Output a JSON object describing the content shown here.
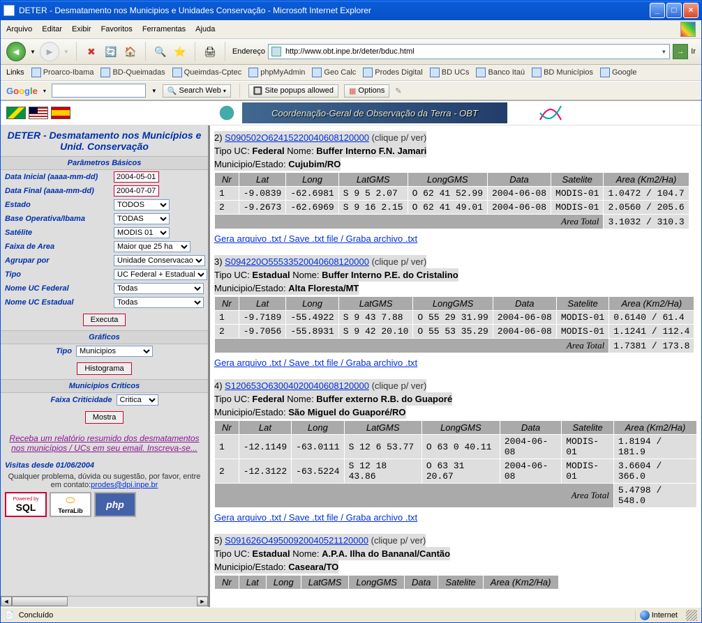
{
  "window": {
    "title": "DETER - Desmatamento nos Municipios e Unidades Conservação - Microsoft Internet Explorer"
  },
  "menus": [
    "Arquivo",
    "Editar",
    "Exibir",
    "Favoritos",
    "Ferramentas",
    "Ajuda"
  ],
  "addr": {
    "label": "Endereço",
    "url": "http://www.obt.inpe.br/deter/bduc.html",
    "go": "Ir"
  },
  "linkbar": {
    "label": "Links",
    "items": [
      "Proarco-Ibama",
      "BD-Queimadas",
      "Queimdas-Cptec",
      "phpMyAdmin",
      "Geo Calc",
      "Prodes Digital",
      "BD UCs",
      "Banco Itaú",
      "BD Municípios",
      "Google"
    ]
  },
  "google": {
    "search": "Search Web",
    "popups": "Site popups allowed",
    "options": "Options"
  },
  "obt_banner": "Coordenação-Geral de Observação da Terra - OBT",
  "left": {
    "title": "DETER - Desmatamento nos Municípios e Unid. Conservação",
    "s_basic": "Parâmetros Básicos",
    "data_ini_lbl": "Data Inicial (aaaa-mm-dd)",
    "data_ini": "2004-05-01",
    "data_fin_lbl": "Data Final (aaaa-mm-dd)",
    "data_fin": "2004-07-07",
    "estado_lbl": "Estado",
    "estado": "TODOS",
    "base_lbl": "Base Operativa/Ibama",
    "base": "TODAS",
    "sat_lbl": "Satélite",
    "sat": "MODIS 01",
    "faixa_lbl": "Faixa de Area",
    "faixa": "Maior que 25 ha",
    "agr_lbl": "Agrupar por",
    "agr": "Unidade Conservacao",
    "tipo_lbl": "Tipo",
    "tipo": "UC Federal + Estadual",
    "nfed_lbl": "Nome UC Federal",
    "nfed": "Todas",
    "nest_lbl": "Nome UC Estadual",
    "nest": "Todas",
    "exec": "Executa",
    "s_graf": "Gráficos",
    "gtipo_lbl": "Tipo",
    "gtipo": "Municipios",
    "hist": "Histograma",
    "s_mun": "Municipios Críticos",
    "crit_lbl": "Faixa Criticidade",
    "crit": "Critica",
    "mostra": "Mostra",
    "promo": "Receba um relatório resumido dos desmatamentos nos municípios / UCs em seu email. Inscreva-se...",
    "visitas": "Visitas desde 01/06/2004",
    "contact_pre": "Qualquer problema, dúvida ou sugestão, por favor, entre em contato:",
    "contact_mail": "prodes@dpi.inpe.br"
  },
  "right": {
    "headers": [
      "Nr",
      "Lat",
      "Long",
      "LatGMS",
      "LongGMS",
      "Data",
      "Satelite",
      "Area (Km2/Ha)"
    ],
    "clique": "(clique p/ ver)",
    "save": "Gera arquivo .txt / Save .txt file / Graba archivo .txt",
    "total_lbl": "Area Total",
    "tipo_lbl": "Tipo UC:",
    "nome_lbl": "Nome:",
    "mun_lbl": "Municipio/Estado:",
    "entries": [
      {
        "n": "2)",
        "link": "S090502O62415220040608120000",
        "tipo": "Federal",
        "nome": "Buffer Interno F.N. Jamari",
        "mun": "Cujubim/RO",
        "rows": [
          [
            "1",
            "-9.0839",
            "-62.6981",
            "S 9 5 2.07",
            "O 62 41 52.99",
            "2004-06-08",
            "MODIS-01",
            "1.0472 / 104.7"
          ],
          [
            "2",
            "-9.2673",
            "-62.6969",
            "S 9 16 2.15",
            "O 62 41 49.01",
            "2004-06-08",
            "MODIS-01",
            "2.0560 / 205.6"
          ]
        ],
        "total": "3.1032 / 310.3"
      },
      {
        "n": "3)",
        "link": "S094220O55533520040608120000",
        "tipo": "Estadual",
        "nome": "Buffer Interno P.E. do Cristalino",
        "mun": "Alta Floresta/MT",
        "rows": [
          [
            "1",
            "-9.7189",
            "-55.4922",
            "S 9 43 7.88",
            "O 55 29 31.99",
            "2004-06-08",
            "MODIS-01",
            "0.6140 / 61.4"
          ],
          [
            "2",
            "-9.7056",
            "-55.8931",
            "S 9 42 20.10",
            "O 55 53 35.29",
            "2004-06-08",
            "MODIS-01",
            "1.1241 / 112.4"
          ]
        ],
        "total": "1.7381 / 173.8"
      },
      {
        "n": "4)",
        "link": "S120653O63004020040608120000",
        "tipo": "Federal",
        "nome": "Buffer externo R.B. do Guaporé",
        "mun": "São Miguel do Guaporé/RO",
        "rows": [
          [
            "1",
            "-12.1149",
            "-63.0111",
            "S 12 6 53.77",
            "O 63 0 40.11",
            "2004-06-08",
            "MODIS-01",
            "1.8194 / 181.9"
          ],
          [
            "2",
            "-12.3122",
            "-63.5224",
            "S 12 18 43.86",
            "O 63 31 20.67",
            "2004-06-08",
            "MODIS-01",
            "3.6604 / 366.0"
          ]
        ],
        "total": "5.4798 / 548.0"
      },
      {
        "n": "5)",
        "link": "S091626O49500920040521120000",
        "tipo": "Estadual",
        "nome": "A.P.A. Ilha do Bananal/Cantão",
        "mun": "Caseara/TO",
        "rows": [],
        "total": null
      }
    ]
  },
  "status": {
    "done": "Concluído",
    "zone": "Internet"
  }
}
